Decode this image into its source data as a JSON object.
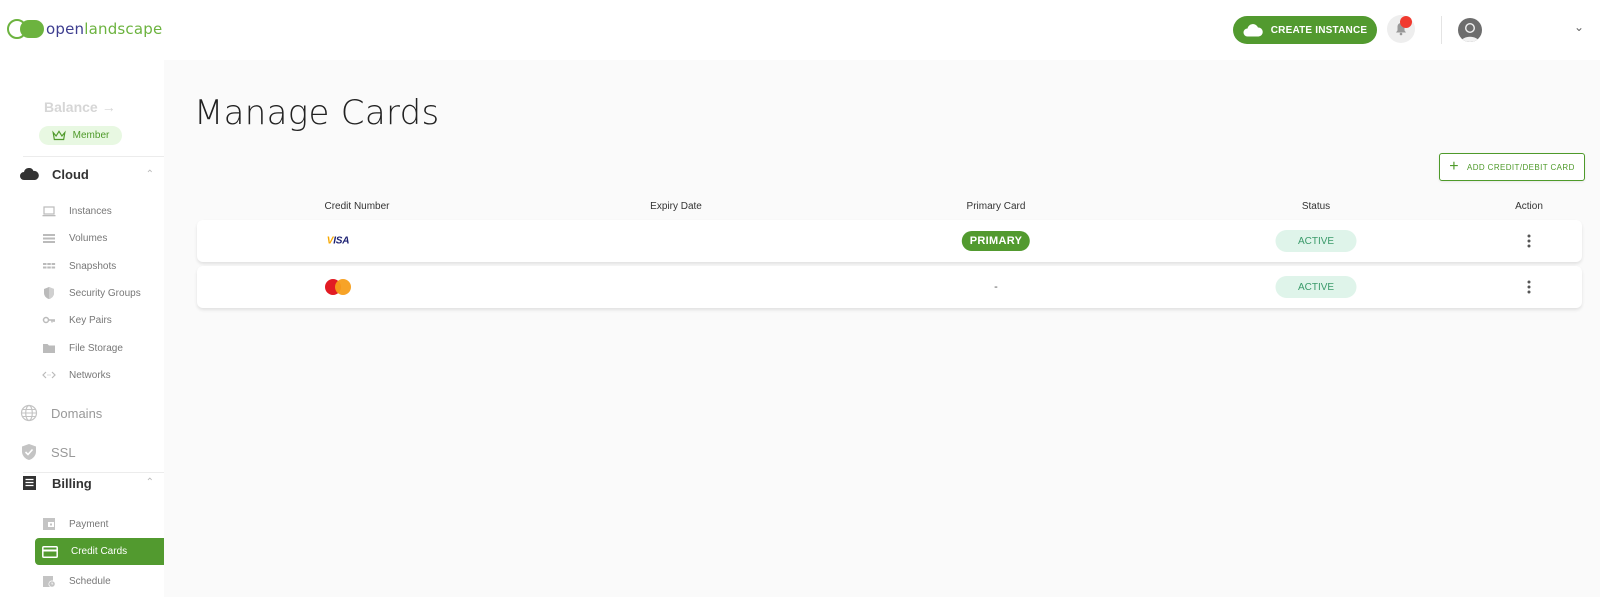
{
  "brand": {
    "name_part1": "open",
    "name_part2": "landscape",
    "accent": "#529a2f"
  },
  "sidebar": {
    "balance_label": "Balance",
    "member_label": "Member",
    "cloud": {
      "label": "Cloud",
      "items": [
        {
          "label": "Instances",
          "icon": "laptop-icon"
        },
        {
          "label": "Volumes",
          "icon": "volumes-icon"
        },
        {
          "label": "Snapshots",
          "icon": "snapshots-icon"
        },
        {
          "label": "Security Groups",
          "icon": "shield-icon"
        },
        {
          "label": "Key Pairs",
          "icon": "key-icon"
        },
        {
          "label": "File Storage",
          "icon": "folder-icon"
        },
        {
          "label": "Networks",
          "icon": "code-icon"
        }
      ]
    },
    "domains_label": "Domains",
    "ssl_label": "SSL",
    "billing": {
      "label": "Billing",
      "items": [
        {
          "label": "Payment",
          "icon": "wallet-icon",
          "active": false
        },
        {
          "label": "Credit Cards",
          "icon": "credit-card-icon",
          "active": true
        },
        {
          "label": "Schedule",
          "icon": "schedule-icon",
          "active": false
        }
      ]
    }
  },
  "topbar": {
    "create_instance_label": "CREATE INSTANCE",
    "notification_status": "unread"
  },
  "main": {
    "title": "Manage Cards",
    "add_card_label": "ADD CREDIT/DEBIT CARD",
    "columns": [
      "Credit Number",
      "Expiry Date",
      "Primary Card",
      "Status",
      "Action"
    ],
    "rows": [
      {
        "brand": "VISA",
        "expiry": "",
        "primary": "PRIMARY",
        "status": "ACTIVE"
      },
      {
        "brand": "MasterCard",
        "expiry": "",
        "primary": "-",
        "status": "ACTIVE"
      }
    ]
  }
}
